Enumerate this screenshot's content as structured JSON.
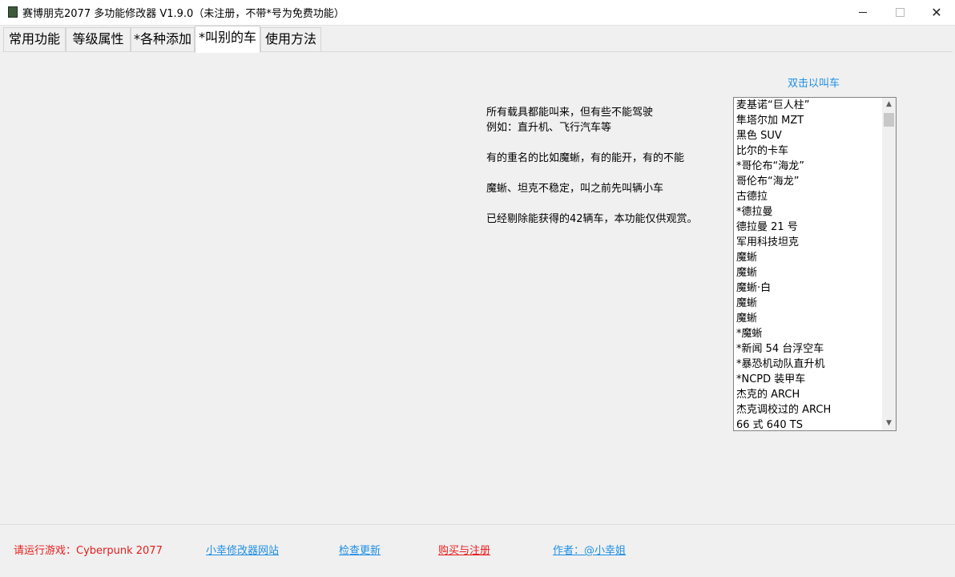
{
  "window": {
    "title": "赛博朋克2077 多功能修改器  V1.9.0（未注册，不带*号为免费功能）",
    "minimize_glyph": "—",
    "maximize_glyph": "☐",
    "close_glyph": "✕"
  },
  "tabs": [
    {
      "label": "常用功能"
    },
    {
      "label": "等级属性"
    },
    {
      "label": "*各种添加"
    },
    {
      "label": "*叫别的车"
    },
    {
      "label": "使用方法"
    }
  ],
  "active_tab": "*叫别的车",
  "info": {
    "lines": [
      "所有载具都能叫来，但有些不能驾驶",
      "例如：直升机、飞行汽车等",
      "有的重名的比如魔蜥，有的能开，有的不能",
      "魔蜥、坦克不稳定，叫之前先叫辆小车",
      "已经剔除能获得的42辆车，本功能仅供观赏。"
    ]
  },
  "vehicle_list": {
    "header": "双击以叫车",
    "items": [
      "麦基诺“巨人柱”",
      "隼塔尔加 MZT",
      "黑色 SUV",
      "比尔的卡车",
      "*哥伦布“海龙”",
      "哥伦布“海龙”",
      "古德拉",
      "*德拉曼",
      "德拉曼 21 号",
      "军用科技坦克",
      "魔蜥",
      "魔蜥",
      "魔蜥·白",
      "魔蜥",
      "魔蜥",
      "*魔蜥",
      "*新闻 54 台浮空车",
      "*暴恐机动队直升机",
      "*NCPD 装甲车",
      "杰克的 ARCH",
      "杰克调校过的 ARCH",
      "66 式 640 TS"
    ],
    "scroll_up_glyph": "▲",
    "scroll_down_glyph": "▼"
  },
  "footer": {
    "status": "请运行游戏：Cyberpunk 2077",
    "site_link": "小幸修改器网站",
    "update_link": "检查更新",
    "buy_link": "购买与注册",
    "author_link": "作者：@小幸姐"
  },
  "colors": {
    "link_blue": "#1e8fe6",
    "alert_red": "#e81c1c",
    "background": "#f0f0f0"
  }
}
